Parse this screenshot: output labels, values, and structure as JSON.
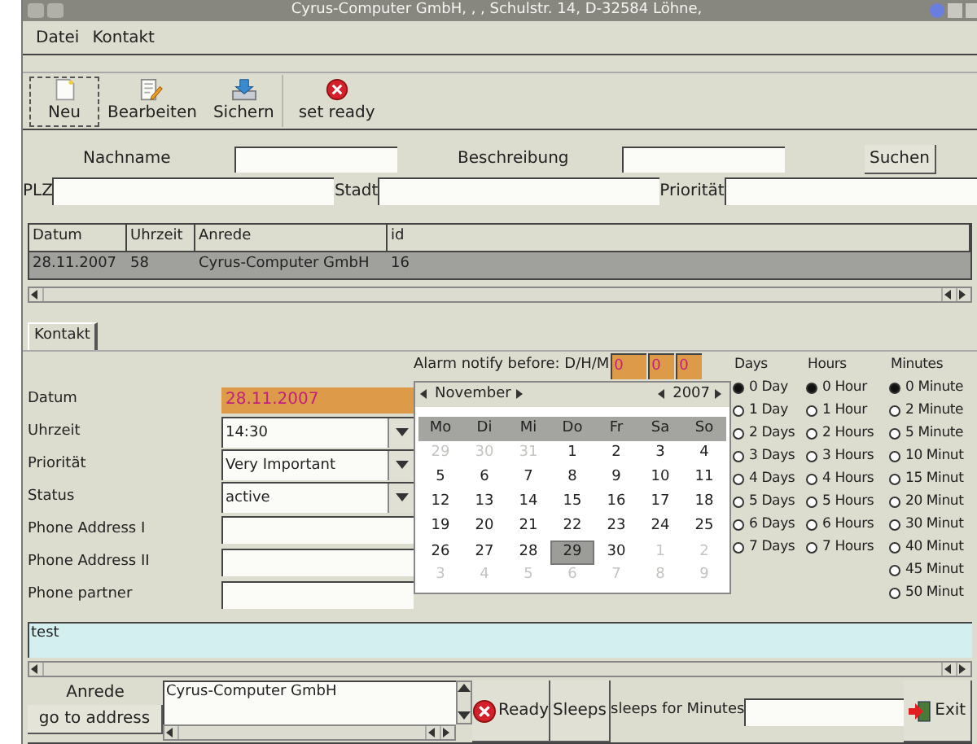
{
  "window": {
    "title": "Cyrus-Computer GmbH, , , Schulstr. 14, D-32584 Löhne,"
  },
  "menu": [
    "Datei",
    "Kontakt"
  ],
  "toolbar": [
    {
      "label": "Neu",
      "kind": "new",
      "focused": true
    },
    {
      "label": "Bearbeiten",
      "kind": "edit",
      "focused": false
    },
    {
      "label": "Sichern",
      "kind": "save",
      "focused": false
    },
    {
      "label": "set ready",
      "kind": "ready",
      "focused": false
    }
  ],
  "search": {
    "row1": [
      "Nachname",
      "Beschreibung"
    ],
    "button": "Suchen",
    "row2": [
      "PLZ",
      "Stadt",
      "Priorität"
    ]
  },
  "table": {
    "columns": [
      "Datum",
      "Uhrzeit",
      "Anrede",
      "id"
    ],
    "rows": [
      {
        "cells": [
          "28.11.2007",
          "58",
          "Cyrus-Computer GmbH",
          "16"
        ],
        "selected": true
      }
    ]
  },
  "tabs": [
    {
      "label": "Kontakt",
      "selected": true
    }
  ],
  "form": [
    {
      "label": "Datum",
      "kind": "date",
      "value": "28.11.2007"
    },
    {
      "label": "Uhrzeit",
      "kind": "combo",
      "value": "14:30"
    },
    {
      "label": "Priorität",
      "kind": "combo",
      "value": "Very Important"
    },
    {
      "label": "Status",
      "kind": "combo",
      "value": "active"
    },
    {
      "label": "Phone Address I",
      "kind": "text"
    },
    {
      "label": "Phone Address II",
      "kind": "text"
    },
    {
      "label": "Phone partner",
      "kind": "text"
    }
  ],
  "alarm": {
    "label": "Alarm notify before: D/H/M",
    "values": [
      "0",
      "0",
      "0"
    ]
  },
  "calendar": {
    "month": "November",
    "year": "2007",
    "weekdays": [
      "Mo",
      "Di",
      "Mi",
      "Do",
      "Fr",
      "Sa",
      "So"
    ],
    "weeks": [
      [
        {
          "day": "29",
          "muted": true,
          "selected": false
        },
        {
          "day": "30",
          "muted": true,
          "selected": false
        },
        {
          "day": "31",
          "muted": true,
          "selected": false
        },
        {
          "day": "1",
          "muted": false,
          "selected": false
        },
        {
          "day": "2",
          "muted": false,
          "selected": false
        },
        {
          "day": "3",
          "muted": false,
          "selected": false
        },
        {
          "day": "4",
          "muted": false,
          "selected": false
        }
      ],
      [
        {
          "day": "5",
          "muted": false,
          "selected": false
        },
        {
          "day": "6",
          "muted": false,
          "selected": false
        },
        {
          "day": "7",
          "muted": false,
          "selected": false
        },
        {
          "day": "8",
          "muted": false,
          "selected": false
        },
        {
          "day": "9",
          "muted": false,
          "selected": false
        },
        {
          "day": "10",
          "muted": false,
          "selected": false
        },
        {
          "day": "11",
          "muted": false,
          "selected": false
        }
      ],
      [
        {
          "day": "12",
          "muted": false,
          "selected": false
        },
        {
          "day": "13",
          "muted": false,
          "selected": false
        },
        {
          "day": "14",
          "muted": false,
          "selected": false
        },
        {
          "day": "15",
          "muted": false,
          "selected": false
        },
        {
          "day": "16",
          "muted": false,
          "selected": false
        },
        {
          "day": "17",
          "muted": false,
          "selected": false
        },
        {
          "day": "18",
          "muted": false,
          "selected": false
        }
      ],
      [
        {
          "day": "19",
          "muted": false,
          "selected": false
        },
        {
          "day": "20",
          "muted": false,
          "selected": false
        },
        {
          "day": "21",
          "muted": false,
          "selected": false
        },
        {
          "day": "22",
          "muted": false,
          "selected": false
        },
        {
          "day": "23",
          "muted": false,
          "selected": false
        },
        {
          "day": "24",
          "muted": false,
          "selected": false
        },
        {
          "day": "25",
          "muted": false,
          "selected": false
        }
      ],
      [
        {
          "day": "26",
          "muted": false,
          "selected": false
        },
        {
          "day": "27",
          "muted": false,
          "selected": false
        },
        {
          "day": "28",
          "muted": false,
          "selected": false
        },
        {
          "day": "29",
          "muted": false,
          "selected": true
        },
        {
          "day": "30",
          "muted": false,
          "selected": false
        },
        {
          "day": "1",
          "muted": true,
          "selected": false
        },
        {
          "day": "2",
          "muted": true,
          "selected": false
        }
      ],
      [
        {
          "day": "3",
          "muted": true,
          "selected": false
        },
        {
          "day": "4",
          "muted": true,
          "selected": false
        },
        {
          "day": "5",
          "muted": true,
          "selected": false
        },
        {
          "day": "6",
          "muted": true,
          "selected": false
        },
        {
          "day": "7",
          "muted": true,
          "selected": false
        },
        {
          "day": "8",
          "muted": true,
          "selected": false
        },
        {
          "day": "9",
          "muted": true,
          "selected": false
        }
      ]
    ]
  },
  "radio_groups": [
    {
      "title": "Days",
      "options": [
        {
          "label": "0 Day",
          "selected": true
        },
        {
          "label": "1 Day",
          "selected": false
        },
        {
          "label": "2 Days",
          "selected": false
        },
        {
          "label": "3 Days",
          "selected": false
        },
        {
          "label": "4 Days",
          "selected": false
        },
        {
          "label": "5 Days",
          "selected": false
        },
        {
          "label": "6 Days",
          "selected": false
        },
        {
          "label": "7 Days",
          "selected": false
        }
      ]
    },
    {
      "title": "Hours",
      "options": [
        {
          "label": "0 Hour",
          "selected": true
        },
        {
          "label": "1 Hour",
          "selected": false
        },
        {
          "label": "2 Hours",
          "selected": false
        },
        {
          "label": "3 Hours",
          "selected": false
        },
        {
          "label": "4 Hours",
          "selected": false
        },
        {
          "label": "5 Hours",
          "selected": false
        },
        {
          "label": "6 Hours",
          "selected": false
        },
        {
          "label": "7 Hours",
          "selected": false
        }
      ]
    },
    {
      "title": "Minutes",
      "options": [
        {
          "label": "0 Minute",
          "selected": true
        },
        {
          "label": "2 Minute",
          "selected": false
        },
        {
          "label": "5 Minute",
          "selected": false
        },
        {
          "label": "10 Minut",
          "selected": false
        },
        {
          "label": "15 Minut",
          "selected": false
        },
        {
          "label": "20 Minut",
          "selected": false
        },
        {
          "label": "30 Minut",
          "selected": false
        },
        {
          "label": "40 Minut",
          "selected": false
        },
        {
          "label": "45 Minut",
          "selected": false
        },
        {
          "label": "50 Minut",
          "selected": false
        }
      ]
    }
  ],
  "notes": {
    "value": "test"
  },
  "bottom": {
    "anrede_label": "Anrede",
    "goto_button": "go to address",
    "address_text": "Cyrus-Computer GmbH",
    "ready_button": "Ready",
    "sleeps_button": "Sleeps",
    "sleeps_label": "sleeps for Minutes",
    "exit_button": "Exit"
  }
}
